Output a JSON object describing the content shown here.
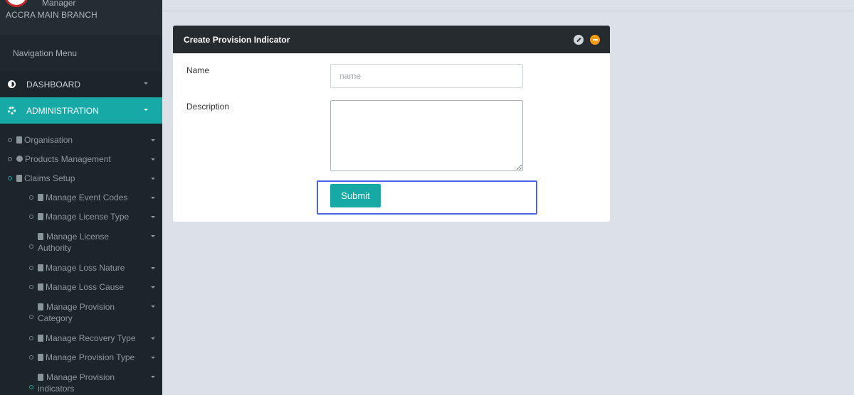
{
  "sidebar": {
    "profile": {
      "role": "Manager",
      "branch": "ACCRA MAIN BRANCH"
    },
    "nav_header": "Navigation Menu",
    "main_items": [
      {
        "label": "DASHBOARD",
        "icon": "half-circle-icon"
      },
      {
        "label": "ADMINISTRATION",
        "icon": "gear-icon",
        "active": true
      }
    ],
    "sub_items": [
      {
        "label": "Organisation",
        "icon": "building-icon"
      },
      {
        "label": "Products Management",
        "icon": "product-icon"
      },
      {
        "label": "Claims Setup",
        "icon": "folder-icon"
      }
    ],
    "claims_items": [
      {
        "label": "Manage Event Codes"
      },
      {
        "label": "Manage License Type"
      },
      {
        "label": "Manage License Authority",
        "line1": "Manage License",
        "line2": "Authority"
      },
      {
        "label": "Manage Loss Nature"
      },
      {
        "label": "Manage Loss Cause"
      },
      {
        "label": "Manage Provision Category",
        "line1": "Manage Provision",
        "line2": "Category"
      },
      {
        "label": "Manage Recovery Type"
      },
      {
        "label": "Manage Provision Type"
      },
      {
        "label": "Manage Provision indicators",
        "line1": "Manage Provision",
        "line2": "indicators"
      }
    ]
  },
  "panel": {
    "title": "Create Provision Indicator",
    "fields": {
      "name_label": "Name",
      "name_placeholder": "name",
      "name_value": "",
      "description_label": "Description",
      "description_value": ""
    },
    "submit_label": "Submit"
  },
  "colors": {
    "accent": "#17a9a5",
    "sidebar_bg": "#1c2529",
    "panel_header_bg": "#252b2f",
    "focus_outline": "#4f63e6",
    "collapse_button": "#f39c12"
  }
}
